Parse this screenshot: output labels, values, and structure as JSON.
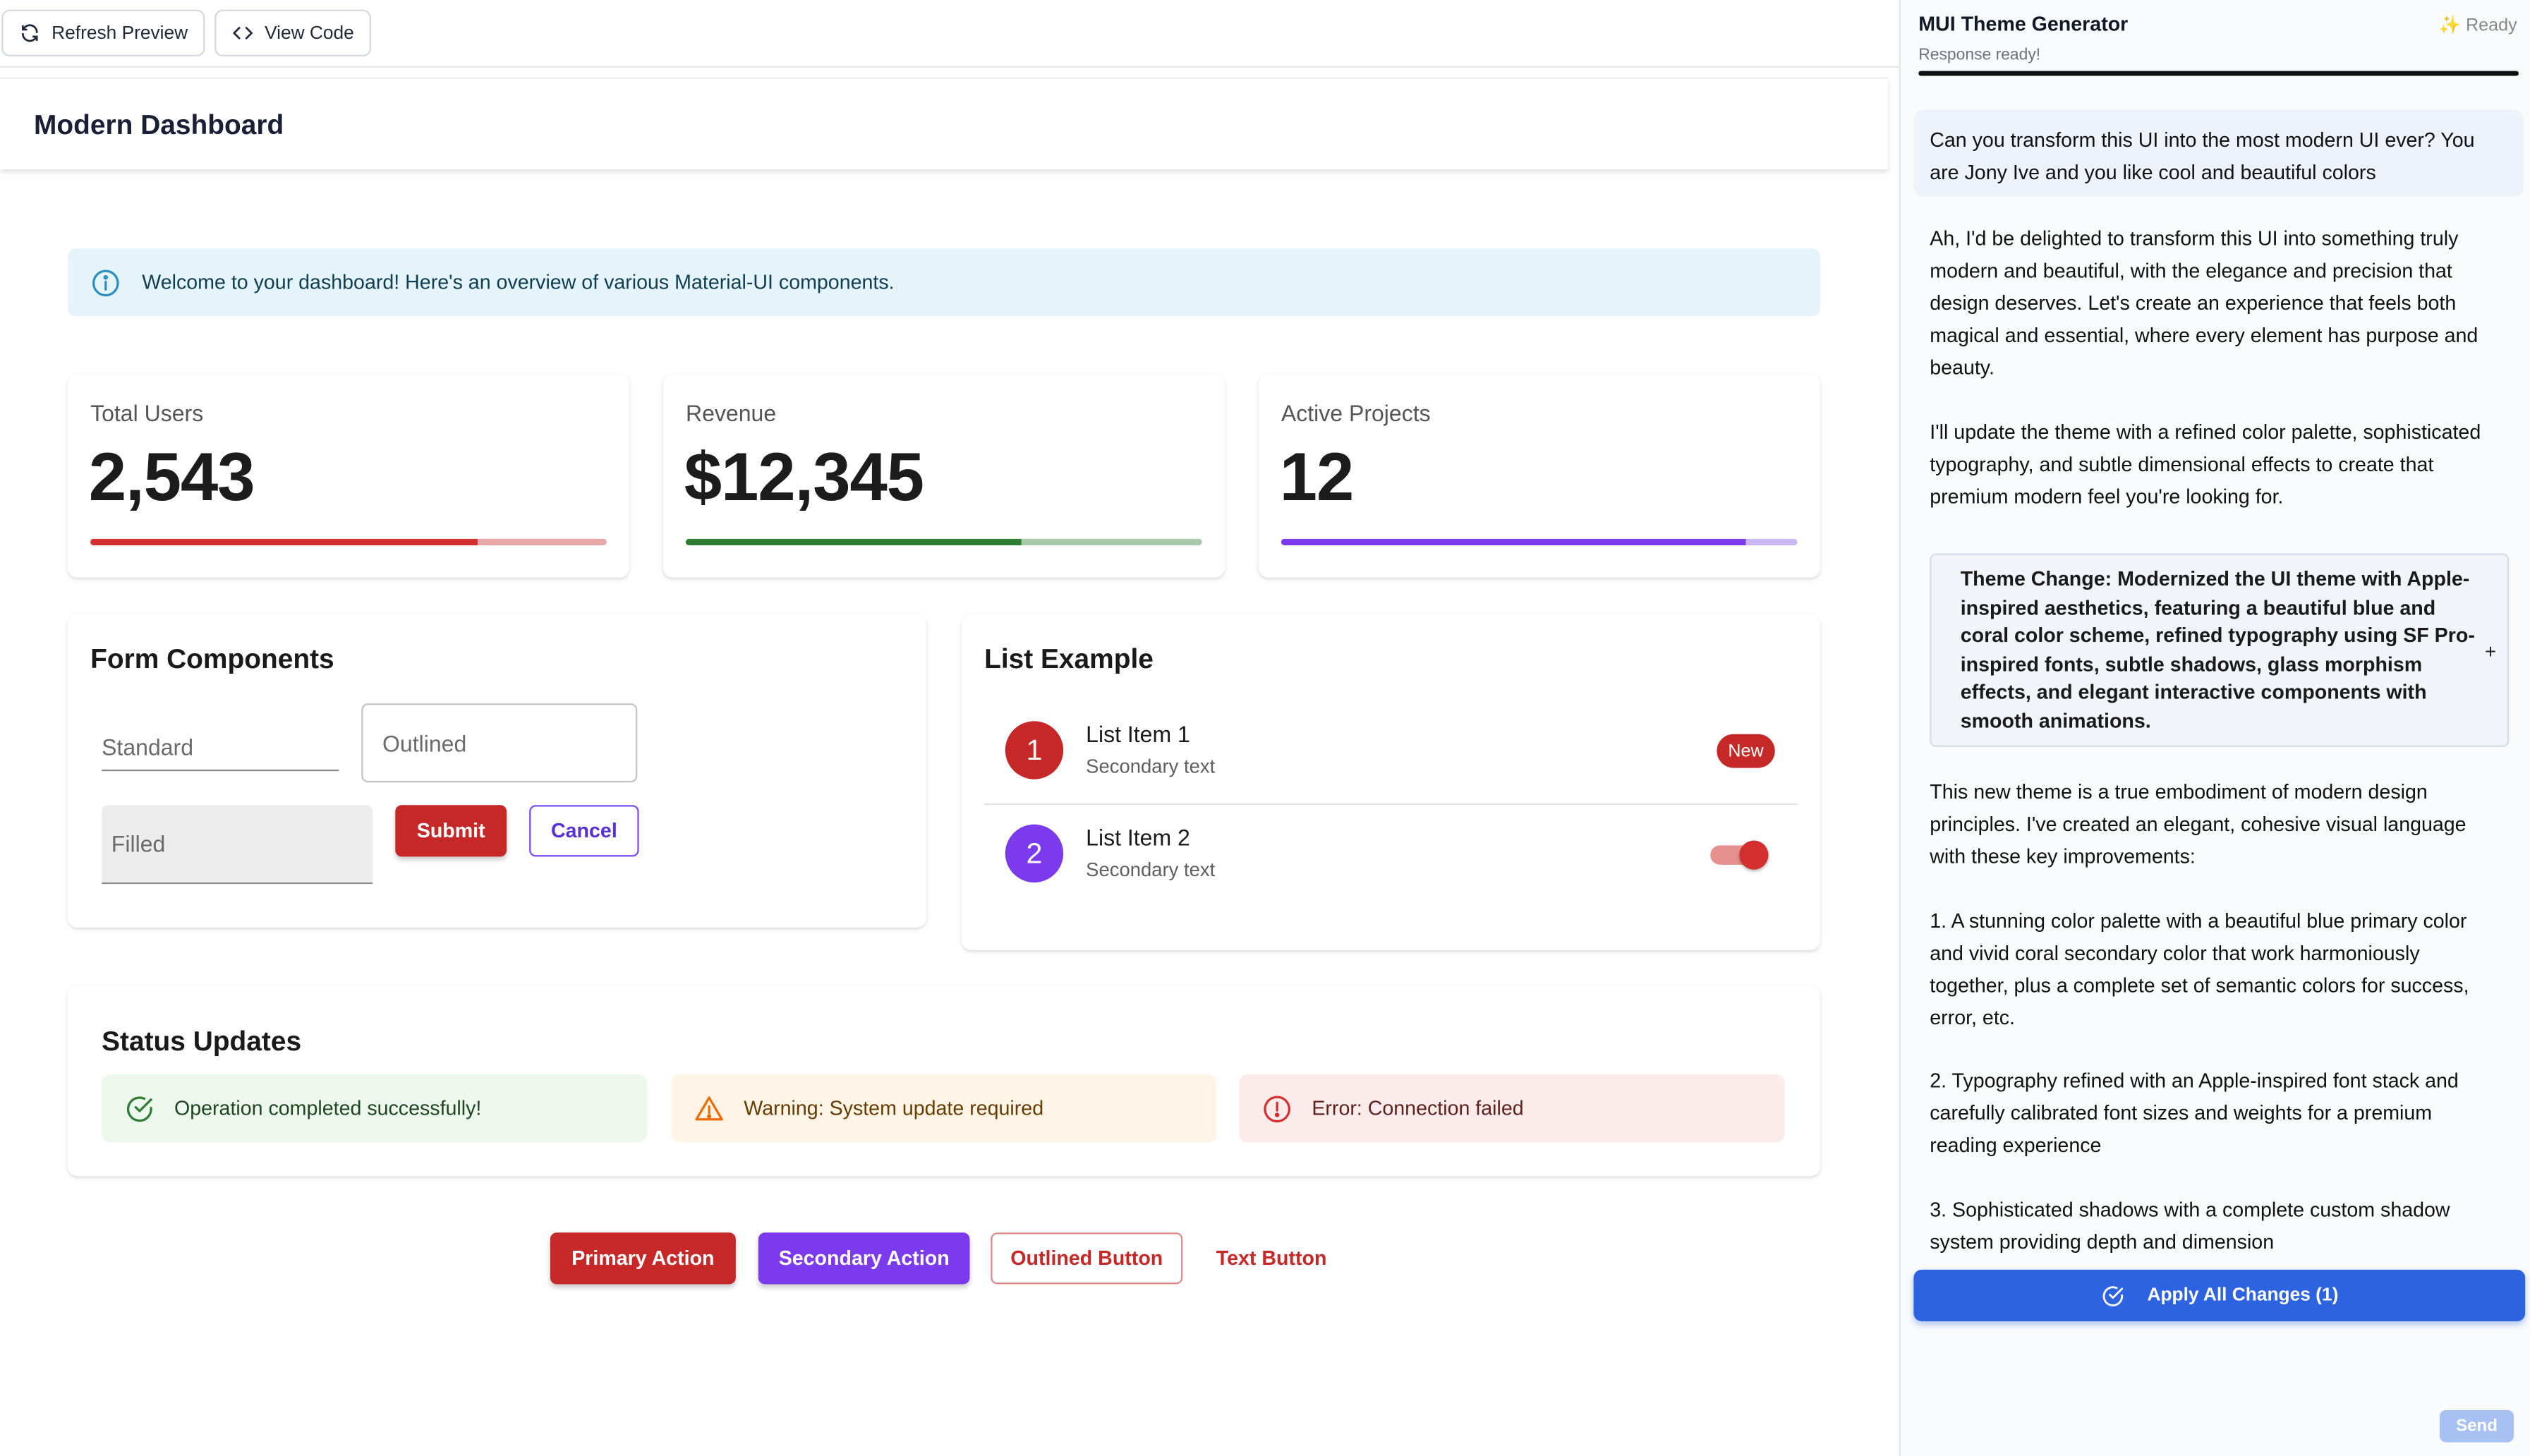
{
  "toolbar": {
    "refresh_label": "Refresh Preview",
    "view_code_label": "View Code"
  },
  "appbar": {
    "title": "Modern Dashboard"
  },
  "info_alert": {
    "text": "Welcome to your dashboard! Here's an overview of various Material-UI components."
  },
  "stats": [
    {
      "label": "Total Users",
      "value": "2,543",
      "progress": 0.75,
      "color": "#d32f2f",
      "track": "#e8a6a6"
    },
    {
      "label": "Revenue",
      "value": "$12,345",
      "progress": 0.65,
      "color": "#2e7d32",
      "track": "#a9c9ab"
    },
    {
      "label": "Active Projects",
      "value": "12",
      "progress": 0.9,
      "color": "#7c3aed",
      "track": "#cbb5f3"
    }
  ],
  "form": {
    "title": "Form Components",
    "standard_label": "Standard",
    "outlined_label": "Outlined",
    "filled_label": "Filled",
    "submit_label": "Submit",
    "cancel_label": "Cancel"
  },
  "list": {
    "title": "List Example",
    "items": [
      {
        "avatar": "1",
        "primary": "List Item 1",
        "secondary": "Secondary text",
        "badge": "New",
        "color": "#c62828"
      },
      {
        "avatar": "2",
        "primary": "List Item 2",
        "secondary": "Secondary text",
        "color": "#7c3aed"
      }
    ]
  },
  "status": {
    "title": "Status Updates",
    "success": "Operation completed successfully!",
    "warning": "Warning: System update required",
    "error": "Error: Connection failed"
  },
  "actions": {
    "primary": "Primary Action",
    "secondary": "Secondary Action",
    "outlined": "Outlined Button",
    "text": "Text Button"
  },
  "chat": {
    "title": "MUI Theme Generator",
    "status": "✨ Ready",
    "subtitle": "Response ready!",
    "user_message": "Can you transform this UI into the most modern UI ever? You are Jony Ive and you like cool and beautiful colors",
    "paragraphs": [
      "Ah, I'd be delighted to transform this UI into something truly modern and beautiful, with the elegance and precision that design deserves. Let's create an experience that feels both magical and essential, where every element has purpose and beauty.",
      "I'll update the theme with a refined color palette, sophisticated typography, and subtle dimensional effects to create that premium modern feel you're looking for."
    ],
    "theme_change": "Theme Change: Modernized the UI theme with Apple-inspired aesthetics, featuring a beautiful blue and coral color scheme, refined typography using SF Pro-inspired fonts, subtle shadows, glass morphism effects, and elegant interactive components with smooth animations.",
    "paragraphs_after": [
      "This new theme is a true embodiment of modern design principles. I've created an elegant, cohesive visual language with these key improvements:",
      "1. A stunning color palette with a beautiful blue primary color and vivid coral secondary color that work harmoniously together, plus a complete set of semantic colors for success, error, etc.",
      "2. Typography refined with an Apple-inspired font stack and carefully calibrated font sizes and weights for a premium reading experience",
      "3. Sophisticated shadows with a complete custom shadow system providing depth and dimension"
    ],
    "apply_label": "Apply All Changes (1)",
    "send_label": "Send"
  }
}
